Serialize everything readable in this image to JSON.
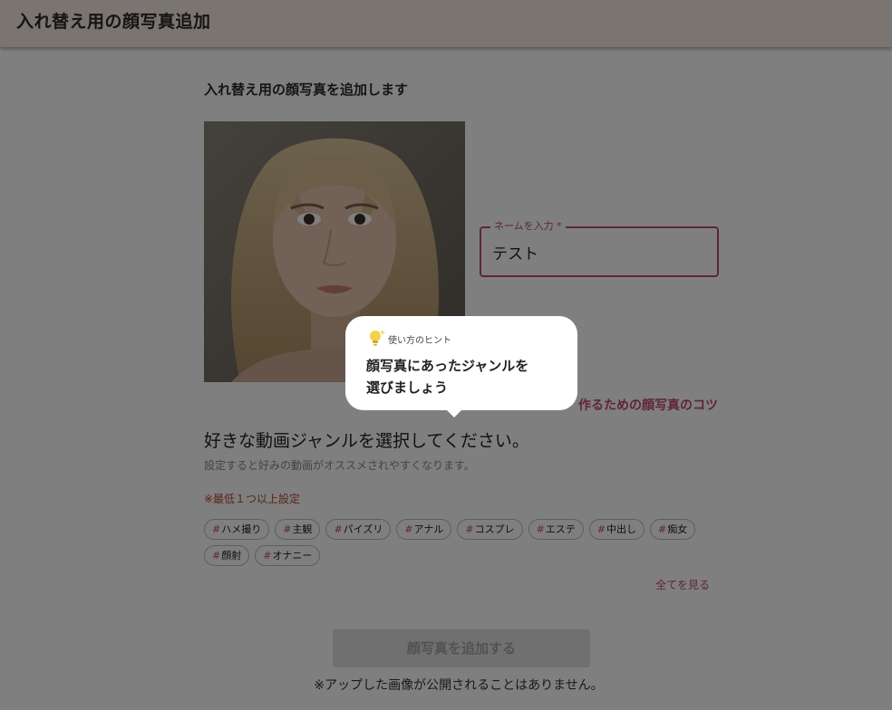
{
  "app_bar": {
    "title": "入れ替え用の顔写真追加"
  },
  "page": {
    "subtitle": "入れ替え用の顔写真を追加します"
  },
  "name_field": {
    "label": "ネームを入力 *",
    "value": "テスト"
  },
  "tips_link": {
    "label": "作るための顔写真のコツ"
  },
  "genre": {
    "heading": "好きな動画ジャンルを選択してください。",
    "description": "設定すると好みの動画がオススメされやすくなります。",
    "minimum_note": "※最低１つ以上設定",
    "chips": [
      "ハメ撮り",
      "主観",
      "パイズリ",
      "アナル",
      "コスプレ",
      "エステ",
      "中出し",
      "痴女",
      "顔射",
      "オナニー"
    ],
    "see_all": "全てを見る"
  },
  "submit": {
    "label": "顔写真を追加する"
  },
  "privacy_note": "※アップした画像が公開されることはありません。",
  "hint": {
    "caption": "使い方のヒント",
    "line1": "顔写真にあったジャンルを",
    "line2": "選びましょう",
    "icon": "lightbulb-icon"
  },
  "colors": {
    "accent": "#c04a6e",
    "app_bar": "#f4ebe3",
    "warning": "#b5462f"
  }
}
